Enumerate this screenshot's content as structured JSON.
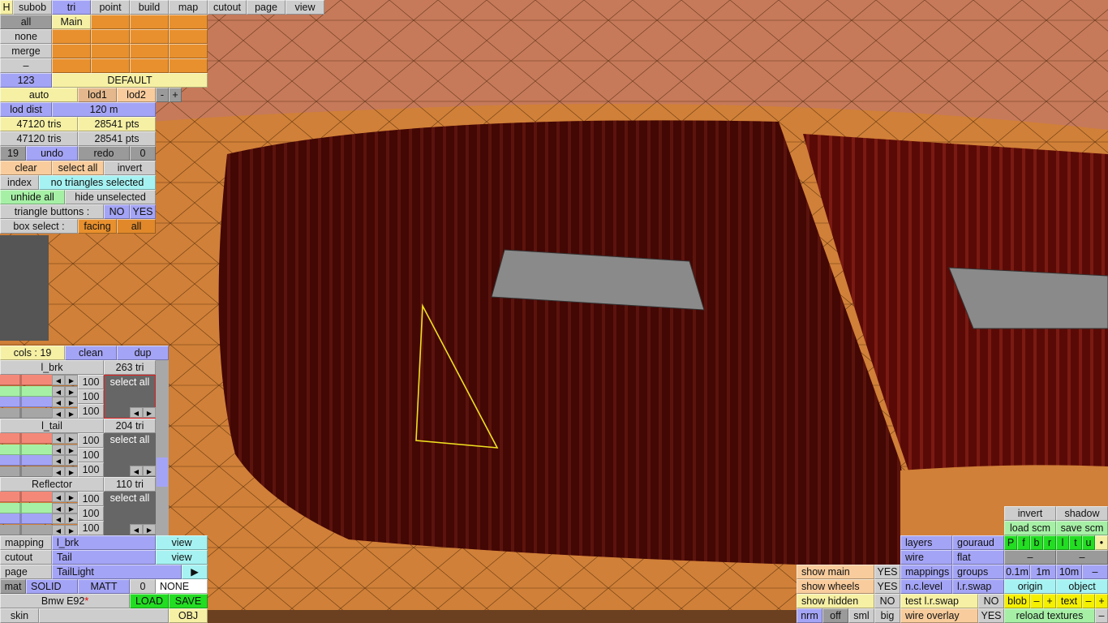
{
  "top_tabs": [
    "H",
    "subob",
    "tri",
    "point",
    "build",
    "map",
    "cutout",
    "page",
    "view"
  ],
  "selection": {
    "all": "all",
    "none": "none",
    "merge": "merge",
    "dash": "–",
    "main": "Main",
    "count": "123",
    "default": "DEFAULT"
  },
  "lod": {
    "auto": "auto",
    "lod1": "lod1",
    "lod2": "lod2",
    "minus": "-",
    "plus": "+",
    "dist_label": "lod dist",
    "dist_value": "120 m"
  },
  "stats": {
    "tris1": "47120 tris",
    "pts1": "28541 pts",
    "tris2": "47120 tris",
    "pts2": "28541 pts"
  },
  "history": {
    "undo_count": "19",
    "undo": "undo",
    "redo": "redo",
    "redo_count": "0"
  },
  "select_ops": {
    "clear": "clear",
    "select_all": "select all",
    "invert": "invert",
    "index": "index",
    "status": "no triangles selected",
    "unhide_all": "unhide all",
    "hide_unselected": "hide unselected",
    "triangle_buttons": "triangle buttons :",
    "no": "NO",
    "yes": "YES",
    "box_select": "box select :",
    "facing": "facing",
    "all": "all"
  },
  "cols": {
    "label": "cols : 19",
    "clean": "clean",
    "dup": "dup"
  },
  "groups": [
    {
      "name": "l_brk",
      "tris": "263 tri",
      "values": [
        "100",
        "100",
        "100"
      ],
      "select": "select all"
    },
    {
      "name": "l_tail",
      "tris": "204 tri",
      "values": [
        "100",
        "100",
        "100"
      ],
      "select": "select all"
    },
    {
      "name": "Reflector",
      "tris": "110 tri",
      "values": [
        "100",
        "100",
        "100"
      ],
      "select": "select all"
    }
  ],
  "bottom_left": {
    "mapping": "mapping",
    "mapping_value": "l_brk",
    "view1": "view",
    "cutout": "cutout",
    "cutout_value": "Tail",
    "view2": "view",
    "page": "page",
    "page_value": "TailLight",
    "page_arrow": "▶",
    "mat": "mat",
    "solid": "SOLID",
    "matt": "MATT",
    "zero": "0",
    "none": "NONE",
    "model": "Bmw E92",
    "modified": "*",
    "load": "LOAD",
    "save": "SAVE",
    "skin": "skin",
    "skin_value": "",
    "obj": "OBJ"
  },
  "bottom_right": {
    "invert": "invert",
    "shadow": "shadow",
    "load_scm": "load scm",
    "save_scm": "save scm",
    "layers": "layers",
    "gouraud": "gouraud",
    "views": [
      "P",
      "f",
      "b",
      "r",
      "l",
      "t",
      "u",
      "•"
    ],
    "wire": "wire",
    "flat": "flat",
    "dash1": "–",
    "dash2": "–",
    "show_main": "show main",
    "show_main_v": "YES",
    "mappings": "mappings",
    "groups": "groups",
    "s01": "0.1m",
    "s1": "1m",
    "s10": "10m",
    "sdash": "–",
    "show_wheels": "show wheels",
    "show_wheels_v": "YES",
    "nclevel": "n.c.level",
    "lrswap": "l.r.swap",
    "origin": "origin",
    "object": "object",
    "show_hidden": "show hidden",
    "show_hidden_v": "NO",
    "test_lrswap": "test l.r.swap",
    "test_lrswap_v": "NO",
    "blob": "blob",
    "blob_minus": "–",
    "blob_plus": "+",
    "text": "text",
    "text_minus": "–",
    "text_plus": "+",
    "nrm": "nrm",
    "off": "off",
    "sml": "sml",
    "big": "big",
    "wire_overlay": "wire overlay",
    "wire_overlay_v": "YES",
    "reload": "reload textures",
    "reload_dash": "–"
  },
  "colors": {
    "orange": "#e8902e",
    "blue": "#a4a4f6",
    "yellow": "#f6f0a4",
    "selection_outline": "#f0e020"
  }
}
